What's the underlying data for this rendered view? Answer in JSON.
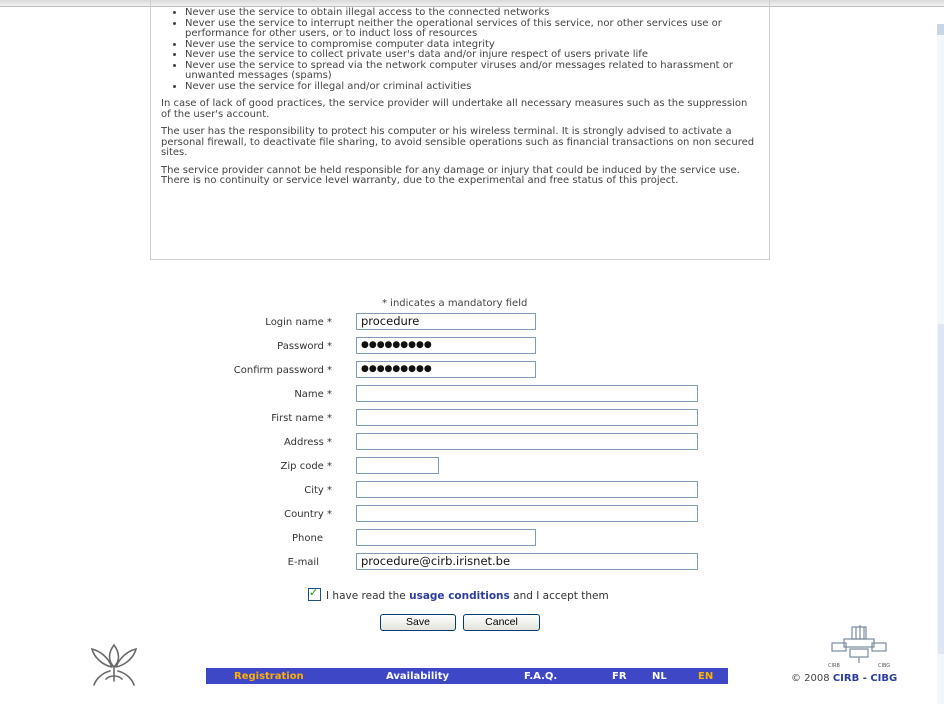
{
  "conditions": {
    "bullets": [
      "Never use the service to obtain illegal access to the connected networks",
      "Never use the service to interrupt neither the operational services of this service, nor other services use or performance for other users, or to induct loss of resources",
      "Never use the service to compromise computer data integrity",
      "Never use the service to collect private user's data and/or injure respect of users private life",
      "Never use the service to spread via the network computer viruses and/or messages related to harassment or unwanted messages (spams)",
      "Never use the service for illegal and/or criminal activities"
    ],
    "p1": "In case of lack of good practices, the service provider will undertake all necessary measures such as the suppression of the user's account.",
    "p2": "The user has the responsibility to protect his computer or his wireless terminal. It is strongly advised to activate a personal firewall, to deactivate file sharing, to avoid sensible operations such as financial transactions on non secured sites.",
    "p3": "The service provider cannot be held responsible for any damage or injury that could be induced by the service use.",
    "p4": "There is no continuity or service level warranty, due to the experimental and free status of this project."
  },
  "form": {
    "mandatory_note": "* indicates a mandatory field",
    "login_label": "Login name *",
    "login_value": "procedure",
    "password_label": "Password *",
    "password_value": "●●●●●●●●●",
    "confirm_label": "Confirm password *",
    "confirm_value": "●●●●●●●●●",
    "name_label": "Name *",
    "firstname_label": "First name *",
    "address_label": "Address *",
    "zip_label": "Zip code *",
    "city_label": "City *",
    "country_label": "Country *",
    "phone_label": "Phone",
    "email_label": "E-mail",
    "email_value": "procedure@cirb.irisnet.be",
    "accept_prefix": "I have read the",
    "accept_link": "usage conditions",
    "accept_suffix": "and I accept them",
    "accept_checked": true,
    "save_label": "Save",
    "cancel_label": "Cancel"
  },
  "nav": {
    "registration": "Registration",
    "availability": "Availability",
    "faq": "F.A.Q.",
    "fr": "FR",
    "nl": "NL",
    "en": "EN",
    "active_color": "#ffb000",
    "bar_color": "#3e48c7"
  },
  "footer": {
    "copyright_prefix": "© 2008",
    "copyright_org": "CIRB - CIBG",
    "logo_left_label": "CIRB",
    "logo_right_label": "CIBG"
  }
}
